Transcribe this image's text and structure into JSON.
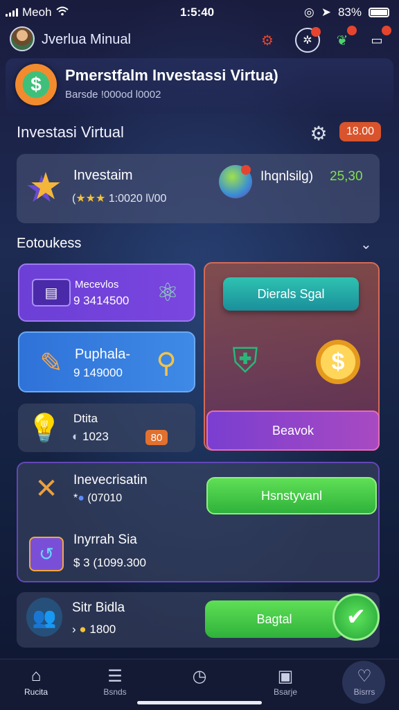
{
  "status_bar": {
    "carrier": "Meoh",
    "time": "1:5:40",
    "battery": "83%"
  },
  "app_bar": {
    "title": "Jverlua Minual",
    "icons": [
      "robot-icon",
      "compass-icon",
      "leaf-icon",
      "chat-icon"
    ]
  },
  "header": {
    "title": "Pmerstfalm Investassi Virtua)",
    "subtitle": "Barsde !000od l0002"
  },
  "section": {
    "title": "Investasi Virtual",
    "badge": "18.00"
  },
  "investment": {
    "title": "Investaim",
    "stars": "★★★",
    "subtitle_prefix": "(",
    "subtitle": "1:0020 l\\/00",
    "right_label": "Ihqnlsilg)",
    "right_value": "25,30",
    "value_color": "#7fe24a"
  },
  "list_header": {
    "title": "Eotoukess"
  },
  "tiles": {
    "purple": {
      "title": "Mecevlos",
      "value": "9 3414500"
    },
    "blue": {
      "title": "Puphala-",
      "value": "9 149000"
    },
    "dark": {
      "title": "Dtita",
      "value": "1023",
      "badge": "80"
    }
  },
  "panel": {
    "top_button": "Dierals Sgal",
    "bottom_button": "Beavok"
  },
  "lower_card": {
    "item1_title": "Inevecrisatin",
    "item1_value": "(07010",
    "item2_title": "Inyrrah Sia",
    "item2_value": "$ 3 (1099.300",
    "action_button": "Hsnstyvanl"
  },
  "bottom_card": {
    "title": "Sitr Bidla",
    "value": "1800",
    "action_button": "Bagtal"
  },
  "tabbar": {
    "tabs": [
      {
        "label": "Rucita",
        "icon": "home-icon"
      },
      {
        "label": "Bsnds",
        "icon": "list-icon"
      },
      {
        "label": "",
        "icon": "clock-icon"
      },
      {
        "label": "Bsarje",
        "icon": "camera-icon"
      },
      {
        "label": "Bisrrs",
        "icon": "heart-icon"
      }
    ]
  },
  "colors": {
    "accent_orange": "#d9542c",
    "accent_green": "#2fb23b",
    "accent_purple": "#7a3ed0"
  }
}
